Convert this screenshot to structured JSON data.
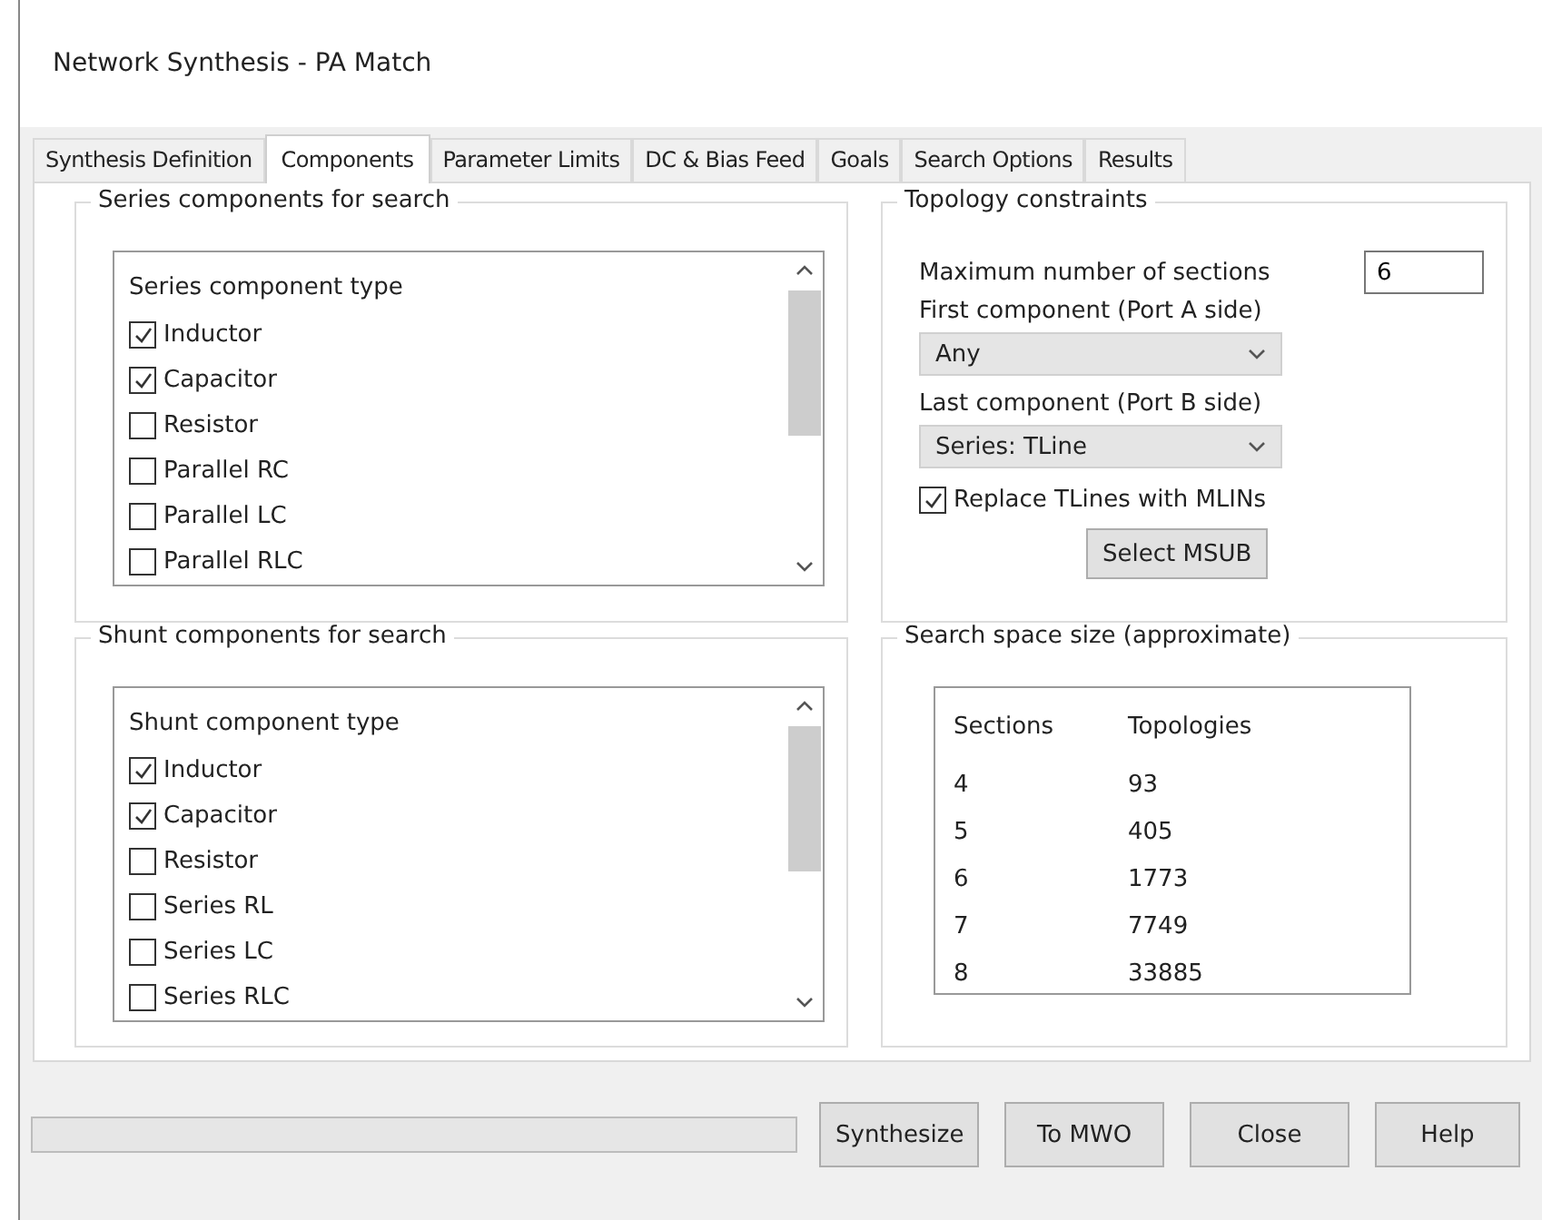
{
  "window": {
    "title": "Network Synthesis - PA Match"
  },
  "tabs": [
    {
      "label": "Synthesis Definition",
      "selected": false
    },
    {
      "label": "Components",
      "selected": true
    },
    {
      "label": "Parameter Limits",
      "selected": false
    },
    {
      "label": "DC & Bias Feed",
      "selected": false
    },
    {
      "label": "Goals",
      "selected": false
    },
    {
      "label": "Search Options",
      "selected": false
    },
    {
      "label": "Results",
      "selected": false
    }
  ],
  "series_group": {
    "title": "Series components for search",
    "header": "Series component type",
    "items": [
      {
        "label": "Inductor",
        "checked": true
      },
      {
        "label": "Capacitor",
        "checked": true
      },
      {
        "label": "Resistor",
        "checked": false
      },
      {
        "label": "Parallel RC",
        "checked": false
      },
      {
        "label": "Parallel LC",
        "checked": false
      },
      {
        "label": "Parallel RLC",
        "checked": false
      }
    ]
  },
  "shunt_group": {
    "title": "Shunt components for search",
    "header": "Shunt component type",
    "items": [
      {
        "label": "Inductor",
        "checked": true
      },
      {
        "label": "Capacitor",
        "checked": true
      },
      {
        "label": "Resistor",
        "checked": false
      },
      {
        "label": "Series RL",
        "checked": false
      },
      {
        "label": "Series LC",
        "checked": false
      },
      {
        "label": "Series RLC",
        "checked": false
      }
    ]
  },
  "topology": {
    "title": "Topology constraints",
    "max_sections_label": "Maximum number of sections",
    "max_sections_value": "6",
    "first_label": "First component (Port A side)",
    "first_value": "Any",
    "last_label": "Last component (Port B side)",
    "last_value": "Series: TLine",
    "replace_label": "Replace TLines with MLINs",
    "replace_checked": true,
    "select_button": "Select MSUB"
  },
  "search_space": {
    "title": "Search space size (approximate)",
    "columns": [
      "Sections",
      "Topologies"
    ],
    "rows": [
      [
        "4",
        "93"
      ],
      [
        "5",
        "405"
      ],
      [
        "6",
        "1773"
      ],
      [
        "7",
        "7749"
      ],
      [
        "8",
        "33885"
      ]
    ]
  },
  "buttons": [
    "Synthesize",
    "To MWO",
    "Close",
    "Help"
  ]
}
